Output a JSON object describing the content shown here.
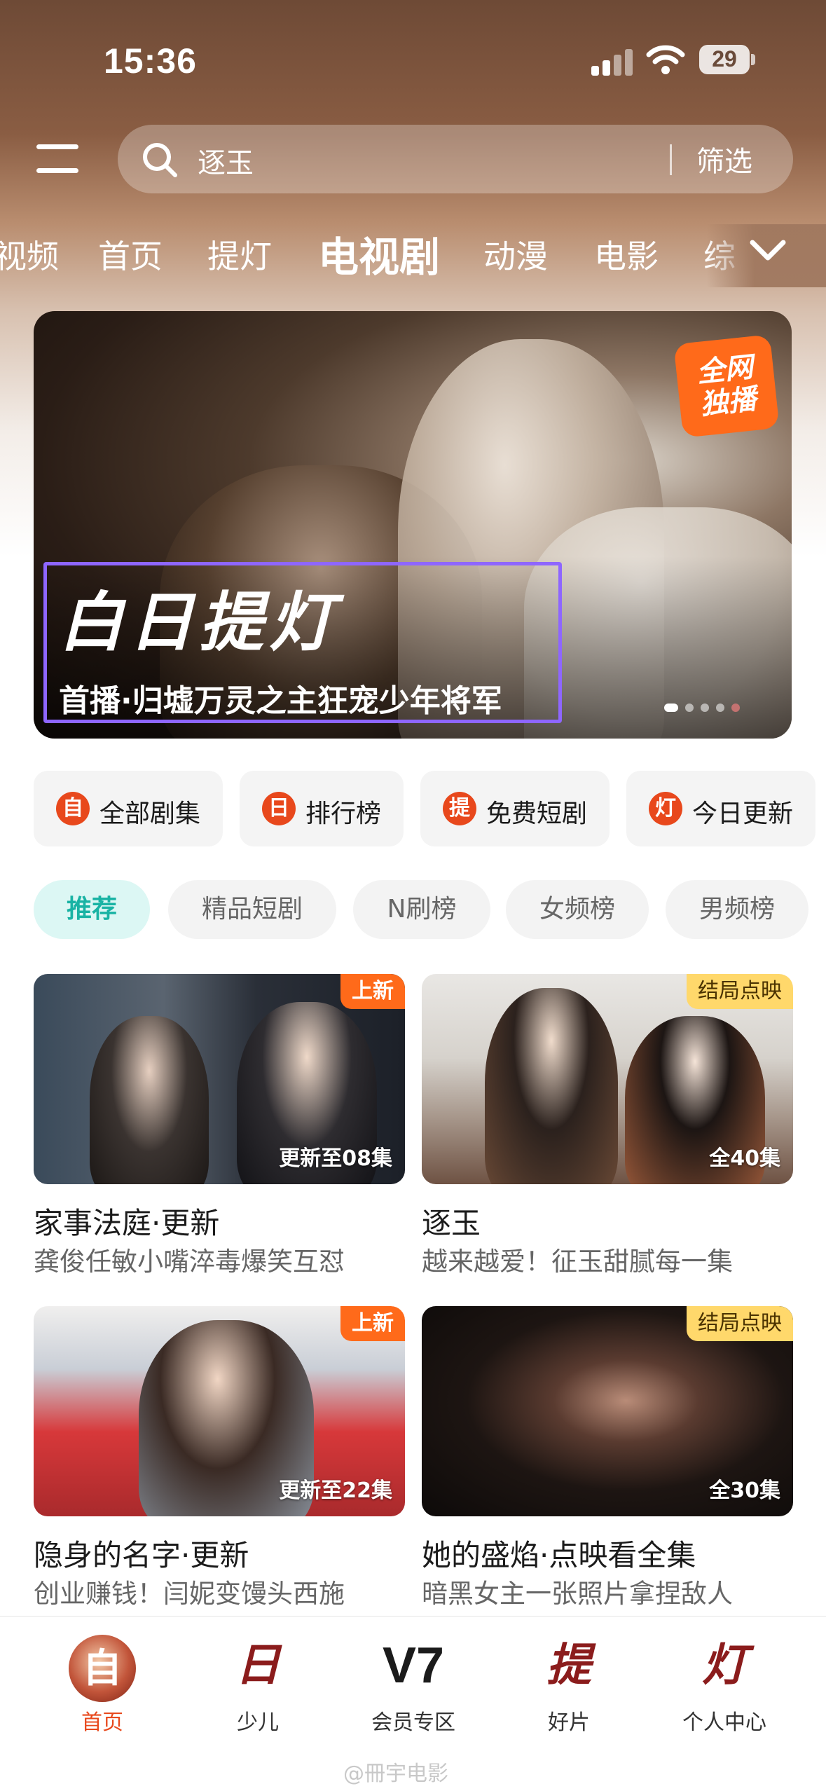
{
  "status_bar": {
    "time": "15:36",
    "battery": "29"
  },
  "search": {
    "query": "逐玉",
    "filter_label": "筛选"
  },
  "channels": [
    "视频",
    "首页",
    "提灯",
    "电视剧",
    "动漫",
    "电影",
    "综"
  ],
  "active_channel": "电视剧",
  "banner": {
    "logo_text": "白日提灯",
    "subtitle": "首播·归墟万灵之主狂宠少年将军",
    "badge_line1": "全网",
    "badge_line2": "独播"
  },
  "quick_entries": [
    {
      "icon": "自",
      "label": "全部剧集"
    },
    {
      "icon": "日",
      "label": "排行榜"
    },
    {
      "icon": "提",
      "label": "免费短剧"
    },
    {
      "icon": "灯",
      "label": "今日更新"
    }
  ],
  "filter_chips": [
    "推荐",
    "精品短剧",
    "N刷榜",
    "女频榜",
    "男频榜"
  ],
  "cards": [
    {
      "tag": "上新",
      "episodes": "更新至08集",
      "title": "家事法庭·更新",
      "desc": "龚俊任敏小嘴淬毒爆笑互怼"
    },
    {
      "tag": "结局点映",
      "episodes": "全40集",
      "title": "逐玉",
      "desc": "越来越爱！征玉甜腻每一集"
    },
    {
      "tag": "上新",
      "episodes": "更新至22集",
      "title": "隐身的名字·更新",
      "desc": "创业赚钱！闫妮变馒头西施"
    },
    {
      "tag": "结局点映",
      "episodes": "全30集",
      "title": "她的盛焰·点映看全集",
      "desc": "暗黑女主一张照片拿捏敌人"
    }
  ],
  "tabbar": [
    {
      "glyph": "自",
      "label": "首页"
    },
    {
      "glyph": "日",
      "label": "少儿"
    },
    {
      "glyph": "V7",
      "label": "会员专区"
    },
    {
      "glyph": "提",
      "label": "好片"
    },
    {
      "glyph": "灯",
      "label": "个人中心"
    }
  ],
  "watermark": "@冊宇电影",
  "colors": {
    "accent_orange": "#ff6a1a",
    "accent_red": "#e8481c",
    "chip_teal": "#19b3a4",
    "finale_tag": "#ffd86b"
  }
}
